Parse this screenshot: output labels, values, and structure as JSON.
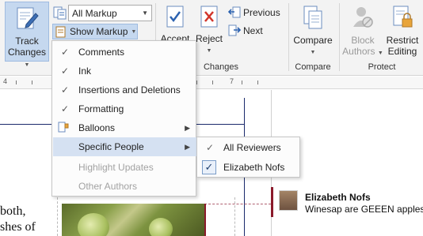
{
  "ribbon": {
    "track_changes": {
      "line1": "Track",
      "line2": "Changes",
      "icon": "track-changes-pencil-icon"
    },
    "markup_select": {
      "value": "All Markup",
      "icon": "markup-display-icon"
    },
    "show_markup": {
      "label": "Show Markup",
      "icon": "show-markup-icon"
    },
    "accept": {
      "label": "Accept",
      "icon": "accept-check-icon"
    },
    "reject": {
      "label": "Reject",
      "icon": "reject-x-icon"
    },
    "previous": {
      "label": "Previous",
      "icon": "previous-change-icon"
    },
    "next": {
      "label": "Next",
      "icon": "next-change-icon"
    },
    "compare": {
      "label": "Compare",
      "icon": "compare-documents-icon"
    },
    "block_authors": {
      "line1": "Block",
      "line2": "Authors",
      "icon": "block-authors-icon"
    },
    "restrict_editing": {
      "line1": "Restrict",
      "line2": "Editing",
      "icon": "restrict-editing-lock-icon"
    },
    "groups": {
      "changes": "Changes",
      "compare": "Compare",
      "protect": "Protect"
    }
  },
  "ruler": {
    "markers": [
      "4",
      "7"
    ]
  },
  "show_markup_menu": {
    "items": [
      {
        "label": "Comments",
        "checked": true,
        "enabled": true
      },
      {
        "label": "Ink",
        "checked": true,
        "enabled": true
      },
      {
        "label": "Insertions and Deletions",
        "checked": true,
        "enabled": true
      },
      {
        "label": "Formatting",
        "checked": true,
        "enabled": true
      },
      {
        "label": "Balloons",
        "checked": false,
        "enabled": true,
        "submenu": true,
        "icon": "balloons-icon"
      },
      {
        "label": "Specific People",
        "checked": false,
        "enabled": true,
        "submenu": true,
        "highlighted": true
      },
      {
        "label": "Highlight Updates",
        "checked": false,
        "enabled": false
      },
      {
        "label": "Other Authors",
        "checked": false,
        "enabled": false
      }
    ]
  },
  "specific_people_submenu": {
    "items": [
      {
        "label": "All Reviewers",
        "checked": true
      },
      {
        "label": "Elizabeth Nofs",
        "checked": true,
        "checkbox": true
      }
    ]
  },
  "document": {
    "text_line1": "both,",
    "text_line2": "shes of"
  },
  "comment": {
    "author": "Elizabeth Nofs",
    "text": "Winesap are GEEEN apples, n"
  },
  "colors": {
    "ribbon_bg": "#f3f3f3",
    "active_button": "#c5d8ef",
    "menu_highlight": "#d5e1f2",
    "comment_accent": "#8b1a2b"
  }
}
